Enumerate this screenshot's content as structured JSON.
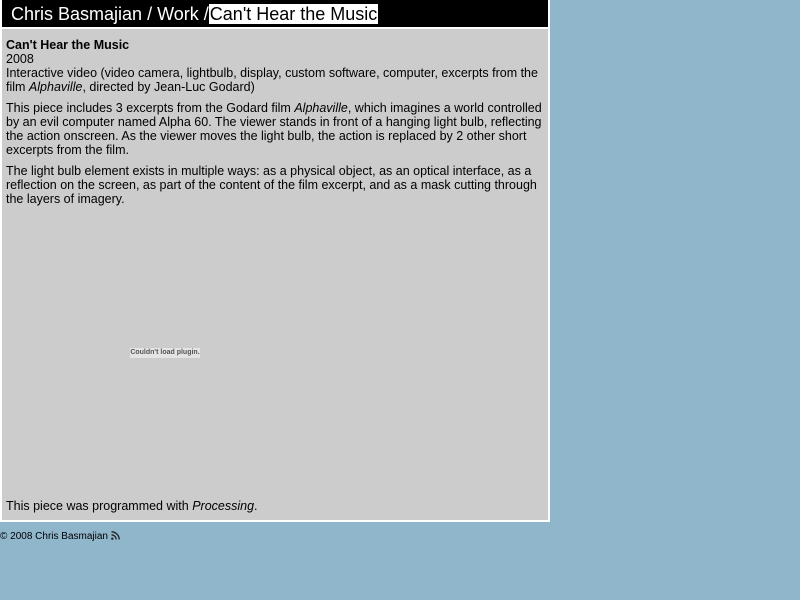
{
  "header": {
    "site_name": "Chris Basmajian",
    "separator": "/",
    "section": "Work",
    "current_page": "Can't Hear the Music"
  },
  "piece": {
    "title": "Can't Hear the Music",
    "year": "2008",
    "medium_prefix": "Interactive video (video camera, lightbulb, display, custom software, computer, excerpts from the film ",
    "medium_film": "Alphaville",
    "medium_suffix": ", directed by Jean-Luc Godard)",
    "para1_prefix": "This piece includes 3 excerpts from the Godard film ",
    "para1_film": "Alphaville",
    "para1_suffix": ", which imagines a world controlled by an evil computer named Alpha 60. The viewer stands in front of a hanging light bulb, reflecting the action onscreen. As the viewer moves the light bulb, the action is replaced by 2 other short excerpts from the film.",
    "para2": "The light bulb element exists in multiple ways: as a physical object, as an optical interface, as a reflection on the screen, as part of the content of the film excerpt, and as a mask cutting through the layers of imagery.",
    "plugin_message": "Couldn't load plugin.",
    "programmed_prefix": "This piece was programmed with ",
    "programmed_tool": "Processing",
    "programmed_suffix": "."
  },
  "footer": {
    "copyright": "© 2008 Chris Basmajian",
    "rss_icon": "rss-icon"
  },
  "colors": {
    "page_background": "#8fb6cb",
    "panel_background": "#cccccc",
    "header_background": "#000000"
  }
}
